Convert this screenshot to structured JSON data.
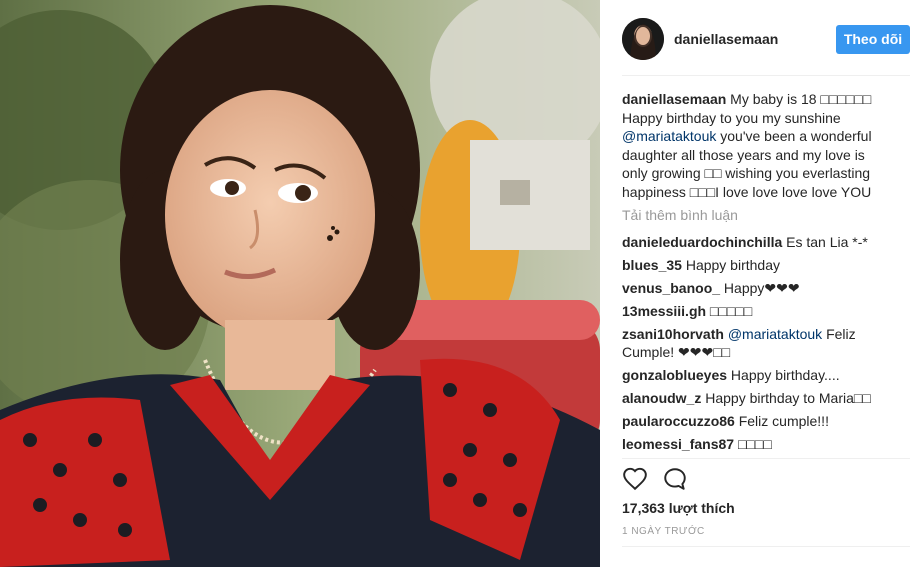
{
  "post": {
    "username": "daniellasemaan",
    "follow_label": "Theo dõi",
    "caption_username": "daniellasemaan",
    "caption_part1": " My baby is 18 □□□□□□ Happy birthday to you my sunshine ",
    "caption_mention": "@mariataktouk",
    "caption_part2": " you've been a wonderful daughter all those years and my love is only growing □□ wishing you everlasting happiness □□□I love love love love YOU",
    "load_more": "Tải thêm bình luận",
    "likes": "17,363 lượt thích",
    "time_ago": "1 NGÀY TRƯỚC"
  },
  "comments": [
    {
      "user": "danieleduardochinchilla",
      "text": " Es tan Lia *-*"
    },
    {
      "user": "blues_35",
      "text": " Happy birthday"
    },
    {
      "user": "venus_banoo_",
      "text": " Happy❤❤❤"
    },
    {
      "user": "13messiii.gh",
      "text": " □□□□□"
    },
    {
      "user": "zsani10horvath",
      "mention": " @mariataktouk",
      "text": " Feliz Cumple! ❤❤❤□□"
    },
    {
      "user": "gonzaloblueyes",
      "text": " Happy birthday...."
    },
    {
      "user": "alanoudw_z",
      "text": " Happy birthday to Maria□□"
    },
    {
      "user": "paularoccuzzo86",
      "text": " Feliz cumple!!!"
    },
    {
      "user": "leomessi_fans87",
      "text": " □□□□"
    }
  ],
  "icons": {
    "like": "heart-outline-icon",
    "comment": "speech-bubble-icon"
  },
  "colors": {
    "follow_button": "#3897f0",
    "mention": "#003569",
    "muted": "#999999"
  }
}
